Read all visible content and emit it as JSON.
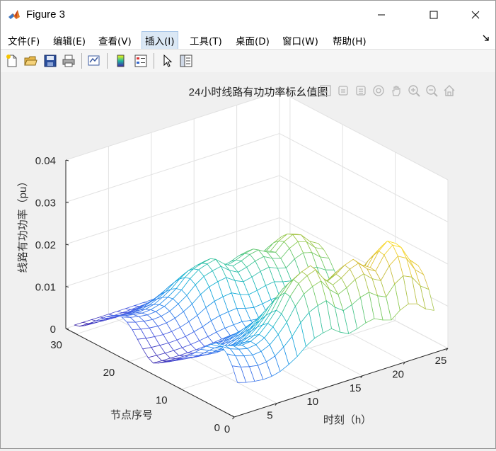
{
  "window": {
    "title": "Figure 3"
  },
  "menu": [
    {
      "label": "文件(F)"
    },
    {
      "label": "编辑(E)"
    },
    {
      "label": "查看(V)"
    },
    {
      "label": "插入(I)"
    },
    {
      "label": "工具(T)"
    },
    {
      "label": "桌面(D)"
    },
    {
      "label": "窗口(W)"
    },
    {
      "label": "帮助(H)"
    }
  ],
  "toolbar_icons": [
    "new-figure-icon",
    "open-file-icon",
    "save-icon",
    "print-icon",
    "link-plot-icon",
    "colorbar-icon",
    "legend-icon",
    "pointer-icon",
    "property-inspector-icon"
  ],
  "axes_toolbar_icons": [
    "save-export-icon",
    "brush-icon",
    "data-tips-icon",
    "rotate-icon",
    "pan-icon",
    "zoom-in-icon",
    "zoom-out-icon",
    "home-icon"
  ],
  "chart_data": {
    "type": "mesh",
    "title": "24小时线路有功功率标幺值图",
    "xlabel": "时刻（h）",
    "ylabel": "节点序号",
    "zlabel": "线路有功功率（pu）",
    "xlim": [
      0,
      25
    ],
    "ylim": [
      0,
      32
    ],
    "zlim": [
      0,
      0.04
    ],
    "xticks": [
      0,
      5,
      10,
      15,
      20,
      25
    ],
    "yticks": [
      0,
      10,
      20,
      30
    ],
    "zticks": [
      0,
      0.01,
      0.02,
      0.03,
      0.04
    ],
    "ztick_labels": [
      "0",
      "0.01",
      "0.02",
      "0.03",
      "0.04"
    ],
    "grid": true,
    "colormap": "parula",
    "x": [
      1,
      2,
      3,
      4,
      5,
      6,
      7,
      8,
      9,
      10,
      11,
      12,
      13,
      14,
      15,
      16,
      17,
      18,
      19,
      20,
      21,
      22,
      23,
      24
    ],
    "y": [
      1,
      2,
      3,
      4,
      5,
      6,
      7,
      8,
      9,
      10,
      11,
      12,
      13,
      14,
      15,
      16,
      17,
      18,
      19,
      20,
      21,
      22,
      23,
      24,
      25,
      26,
      27,
      28,
      29,
      30,
      31,
      32
    ],
    "load_profile": [
      0.55,
      0.5,
      0.47,
      0.45,
      0.46,
      0.5,
      0.58,
      0.68,
      0.82,
      0.92,
      0.97,
      1.0,
      0.88,
      0.8,
      0.84,
      0.9,
      0.93,
      0.85,
      0.8,
      0.93,
      1.0,
      0.95,
      0.8,
      0.72
    ],
    "node_amplitude": [
      0.0125,
      0.0185,
      0.0225,
      0.0245,
      0.0248,
      0.023,
      0.021,
      0.0185,
      0.016,
      0.0135,
      0.0115,
      0.0095,
      0.0078,
      0.006,
      0.0045,
      0.003,
      0.0018,
      0.003,
      0.0055,
      0.0085,
      0.0115,
      0.0135,
      0.0145,
      0.014,
      0.0128,
      0.011,
      0.009,
      0.0068,
      0.0045,
      0.0025,
      0.001,
      0.0003
    ]
  }
}
